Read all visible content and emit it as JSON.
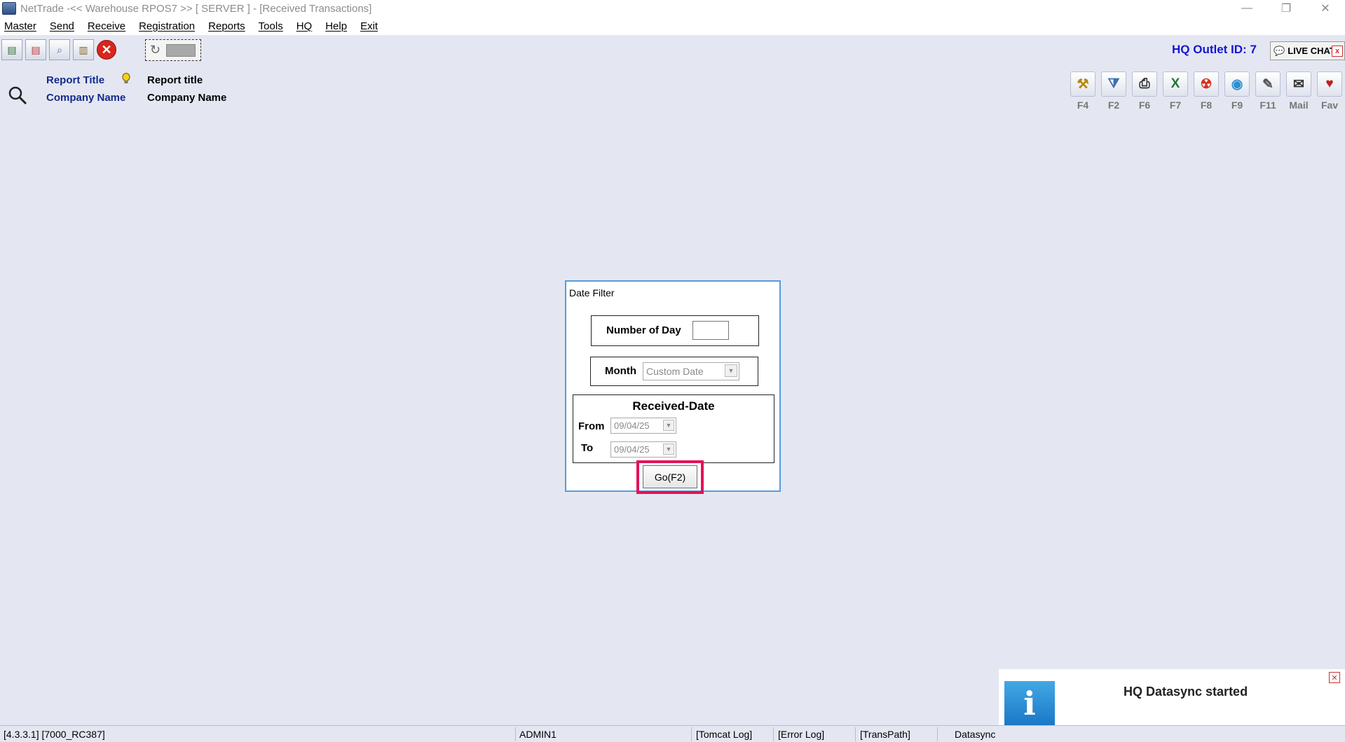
{
  "window": {
    "title": "NetTrade -<< Warehouse RPOS7 >> [ SERVER ]  - [Received Transactions]",
    "minimize": "—",
    "restore": "❐",
    "close": "✕"
  },
  "menu": [
    "Master",
    "Send",
    "Receive",
    "Registration",
    "Reports",
    "Tools",
    "HQ",
    "Help",
    "Exit"
  ],
  "toolbar": {
    "icons": [
      "new-doc-icon",
      "delete-doc-icon",
      "search-doc-icon",
      "clipboard-icon",
      "close-red-icon"
    ],
    "close_glyph": "✕",
    "refresh_glyph": "↻"
  },
  "header": {
    "hq_outlet": "HQ Outlet ID: 7",
    "live_chat": "LIVE CHAT",
    "live_chat_close": "x"
  },
  "report": {
    "title_label": "Report Title",
    "title_value": "Report title",
    "company_label": "Company Name",
    "company_value": "Company Name"
  },
  "right_tools": [
    {
      "icon": "tools-icon",
      "glyph": "⚒",
      "key": "F4",
      "color": "#b8860b"
    },
    {
      "icon": "filter-icon",
      "glyph": "⧩",
      "key": "F2",
      "color": "#3a6fb0"
    },
    {
      "icon": "print-icon",
      "glyph": "⎙",
      "key": "F6",
      "color": "#333333"
    },
    {
      "icon": "excel-icon",
      "glyph": "X",
      "key": "F7",
      "color": "#1e7a2e"
    },
    {
      "icon": "pdf-icon",
      "glyph": "☢",
      "key": "F8",
      "color": "#d9321c"
    },
    {
      "icon": "html-icon",
      "glyph": "◉",
      "key": "F9",
      "color": "#2f8fd0"
    },
    {
      "icon": "edit-icon",
      "glyph": "✎",
      "key": "F11",
      "color": "#555555"
    },
    {
      "icon": "mail-icon",
      "glyph": "✉",
      "key": "Mail",
      "color": "#333333"
    },
    {
      "icon": "favorite-icon",
      "glyph": "♥",
      "key": "Fav",
      "color": "#c0201a"
    }
  ],
  "dialog": {
    "title": "Date Filter",
    "number_of_day_label": "Number of Day",
    "number_of_day_value": "",
    "month_label": "Month",
    "month_value": "Custom Date",
    "received_date_title": "Received-Date",
    "from_label": "From",
    "from_value": "09/04/25",
    "to_label": "To",
    "to_value": "09/04/25",
    "go_button": "Go(F2)"
  },
  "notification": {
    "message": "HQ Datasync started",
    "icon_glyph": "i",
    "close": "✕"
  },
  "statusbar": {
    "version": "[4.3.3.1] [7000_RC387]",
    "user": "ADMIN1",
    "tomcat_log": "[Tomcat Log]",
    "error_log": "[Error Log]",
    "trans_path": "[TransPath]",
    "datasync": "Datasync"
  }
}
